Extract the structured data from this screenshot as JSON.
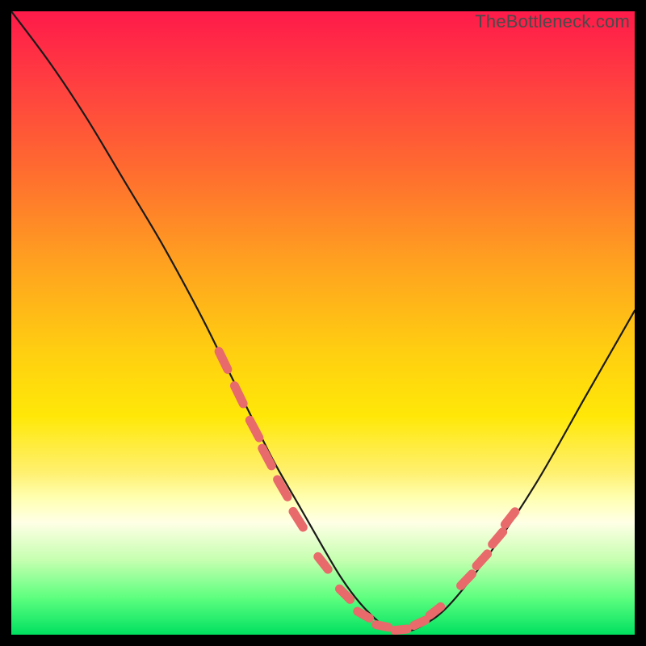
{
  "watermark": "TheBottleneck.com",
  "colors": {
    "frame": "#000000",
    "curve": "#1a1a1a",
    "marker": "#e86a6a",
    "gradient_top": "#ff1a4a",
    "gradient_bottom": "#00e060"
  },
  "chart_data": {
    "type": "line",
    "title": "",
    "xlabel": "",
    "ylabel": "",
    "xlim": [
      0,
      100
    ],
    "ylim": [
      0,
      100
    ],
    "series": [
      {
        "name": "bottleneck-curve",
        "x": [
          0,
          6,
          12,
          18,
          24,
          30,
          34,
          38,
          42,
          46,
          50,
          53,
          56,
          59,
          61,
          63,
          66,
          70,
          76,
          84,
          92,
          100
        ],
        "values": [
          100,
          92,
          83,
          73,
          63,
          52,
          44,
          36,
          28,
          21,
          14,
          9,
          5,
          2,
          0.6,
          0.4,
          1.5,
          4.5,
          12,
          24,
          38,
          52
        ]
      }
    ],
    "markers": {
      "name": "highlight-dashes",
      "segments": [
        {
          "x": 34.0,
          "y": 44.0,
          "len": 3.2,
          "angle": -64
        },
        {
          "x": 36.5,
          "y": 38.5,
          "len": 3.2,
          "angle": -64
        },
        {
          "x": 39.0,
          "y": 33.0,
          "len": 3.2,
          "angle": -62
        },
        {
          "x": 41.0,
          "y": 28.5,
          "len": 3.2,
          "angle": -62
        },
        {
          "x": 43.5,
          "y": 23.5,
          "len": 3.2,
          "angle": -60
        },
        {
          "x": 46.0,
          "y": 18.5,
          "len": 3.0,
          "angle": -58
        },
        {
          "x": 50.0,
          "y": 11.5,
          "len": 2.6,
          "angle": -52
        },
        {
          "x": 53.5,
          "y": 6.5,
          "len": 2.4,
          "angle": -45
        },
        {
          "x": 56.5,
          "y": 3.2,
          "len": 2.2,
          "angle": -30
        },
        {
          "x": 59.5,
          "y": 1.4,
          "len": 2.0,
          "angle": -12
        },
        {
          "x": 62.5,
          "y": 0.8,
          "len": 2.0,
          "angle": 6
        },
        {
          "x": 65.5,
          "y": 1.9,
          "len": 2.0,
          "angle": 25
        },
        {
          "x": 68.0,
          "y": 3.8,
          "len": 2.2,
          "angle": 38
        },
        {
          "x": 73.0,
          "y": 8.8,
          "len": 2.6,
          "angle": 46
        },
        {
          "x": 75.5,
          "y": 12.0,
          "len": 2.6,
          "angle": 48
        },
        {
          "x": 78.0,
          "y": 15.5,
          "len": 2.6,
          "angle": 50
        },
        {
          "x": 80.0,
          "y": 18.7,
          "len": 2.6,
          "angle": 52
        }
      ]
    }
  }
}
